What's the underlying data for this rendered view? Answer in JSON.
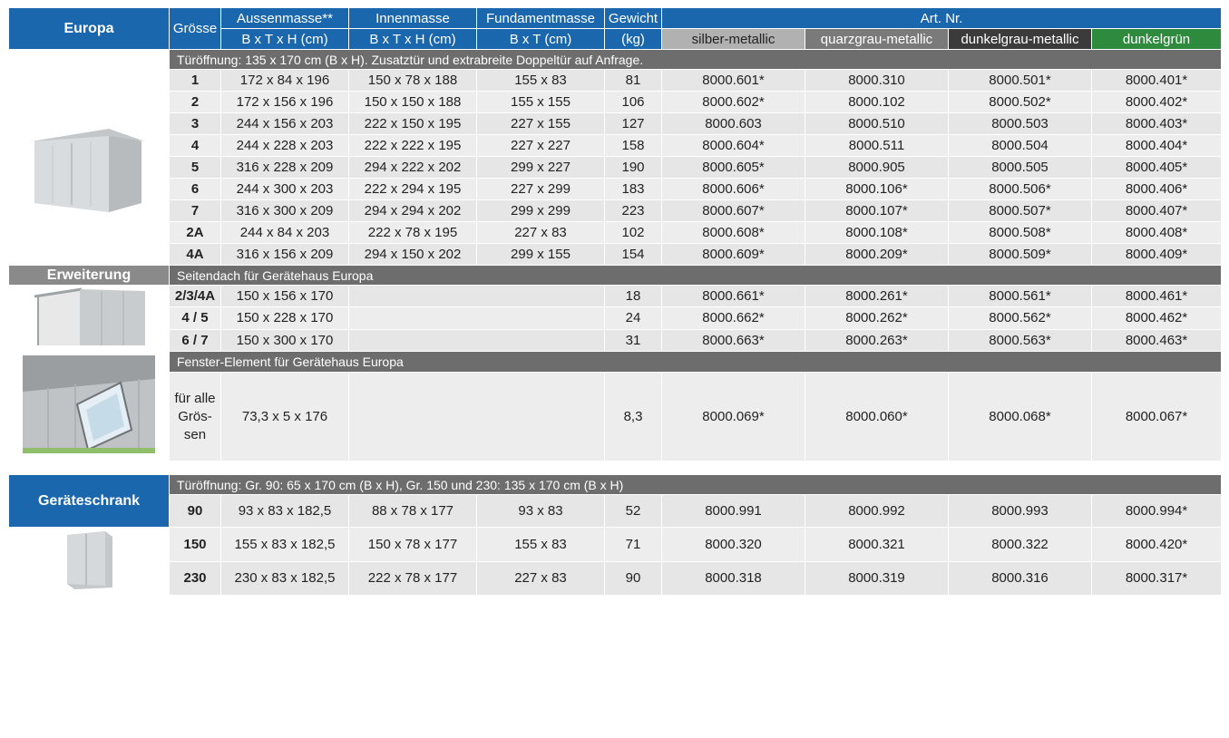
{
  "header": {
    "section_main": "Europa",
    "groesse": "Grösse",
    "aussen": "Aussenmasse**",
    "innen": "Innenmasse",
    "fundament": "Fundamentmasse",
    "gewicht": "Gewicht",
    "artnr": "Art. Nr.",
    "aussen_unit": "B x T x H (cm)",
    "innen_unit": "B x T x H (cm)",
    "fundament_unit": "B x T (cm)",
    "gewicht_unit": "(kg)",
    "colors": [
      "silber-metallic",
      "quarzgrau-metallic",
      "dunkelgrau-metallic",
      "dunkelgrün"
    ]
  },
  "colors": {
    "blue": "#1a67ad",
    "section_gray": "#6d6d6d",
    "silber": "#b1b1b1",
    "quarzgrau": "#7a7a7a",
    "dunkelgrau": "#3b3b3b",
    "dunkelgruen": "#2e8a3d"
  },
  "europa": {
    "note": "Türöffnung: 135 x 170 cm (B x H). Zusatztür und extrabreite Doppeltür auf Anfrage.",
    "rows": [
      [
        "1",
        "172 x 84 x 196",
        "150 x 78 x 188",
        "155 x 83",
        "81",
        "8000.601*",
        "8000.310",
        "8000.501*",
        "8000.401*"
      ],
      [
        "2",
        "172 x 156 x 196",
        "150 x 150 x 188",
        "155 x 155",
        "106",
        "8000.602*",
        "8000.102",
        "8000.502*",
        "8000.402*"
      ],
      [
        "3",
        "244 x 156 x 203",
        "222 x 150 x 195",
        "227 x 155",
        "127",
        "8000.603",
        "8000.510",
        "8000.503",
        "8000.403*"
      ],
      [
        "4",
        "244 x 228 x 203",
        "222 x 222 x 195",
        "227 x 227",
        "158",
        "8000.604*",
        "8000.511",
        "8000.504",
        "8000.404*"
      ],
      [
        "5",
        "316 x 228 x 209",
        "294 x 222 x 202",
        "299 x 227",
        "190",
        "8000.605*",
        "8000.905",
        "8000.505",
        "8000.405*"
      ],
      [
        "6",
        "244 x 300 x 203",
        "222 x 294 x 195",
        "227 x 299",
        "183",
        "8000.606*",
        "8000.106*",
        "8000.506*",
        "8000.406*"
      ],
      [
        "7",
        "316 x 300 x 209",
        "294 x 294 x 202",
        "299 x 299",
        "223",
        "8000.607*",
        "8000.107*",
        "8000.507*",
        "8000.407*"
      ],
      [
        "2A",
        "244 x 84 x 203",
        "222 x 78 x 195",
        "227 x 83",
        "102",
        "8000.608*",
        "8000.108*",
        "8000.508*",
        "8000.408*"
      ],
      [
        "4A",
        "316 x 156 x 209",
        "294 x 150 x 202",
        "299 x 155",
        "154",
        "8000.609*",
        "8000.209*",
        "8000.509*",
        "8000.409*"
      ]
    ]
  },
  "erweiterung": {
    "label": "Erweiterung",
    "note": "Seitendach für Gerätehaus Europa",
    "rows": [
      [
        "2/3/4A",
        "150 x 156 x 170",
        "",
        "",
        "18",
        "8000.661*",
        "8000.261*",
        "8000.561*",
        "8000.461*"
      ],
      [
        "4 / 5",
        "150 x 228 x 170",
        "",
        "",
        "24",
        "8000.662*",
        "8000.262*",
        "8000.562*",
        "8000.462*"
      ],
      [
        "6 / 7",
        "150 x 300 x 170",
        "",
        "",
        "31",
        "8000.663*",
        "8000.263*",
        "8000.563*",
        "8000.463*"
      ]
    ]
  },
  "fenster": {
    "note": "Fenster-Element für Gerätehaus Europa",
    "groesse": "für alle Grös-sen",
    "row": [
      "73,3 x 5 x 176",
      "",
      "",
      "8,3",
      "8000.069*",
      "8000.060*",
      "8000.068*",
      "8000.067*"
    ]
  },
  "schrank": {
    "label": "Geräteschrank",
    "note": "Türöffnung: Gr. 90: 65 x 170 cm (B x H), Gr. 150 und 230: 135 x 170 cm (B x H)",
    "rows": [
      [
        "90",
        "93 x 83 x 182,5",
        "88 x 78 x 177",
        "93 x 83",
        "52",
        "8000.991",
        "8000.992",
        "8000.993",
        "8000.994*"
      ],
      [
        "150",
        "155 x 83 x 182,5",
        "150 x 78 x 177",
        "155 x 83",
        "71",
        "8000.320",
        "8000.321",
        "8000.322",
        "8000.420*"
      ],
      [
        "230",
        "230 x 83 x 182,5",
        "222 x 78 x 177",
        "227 x 83",
        "90",
        "8000.318",
        "8000.319",
        "8000.316",
        "8000.317*"
      ]
    ]
  }
}
